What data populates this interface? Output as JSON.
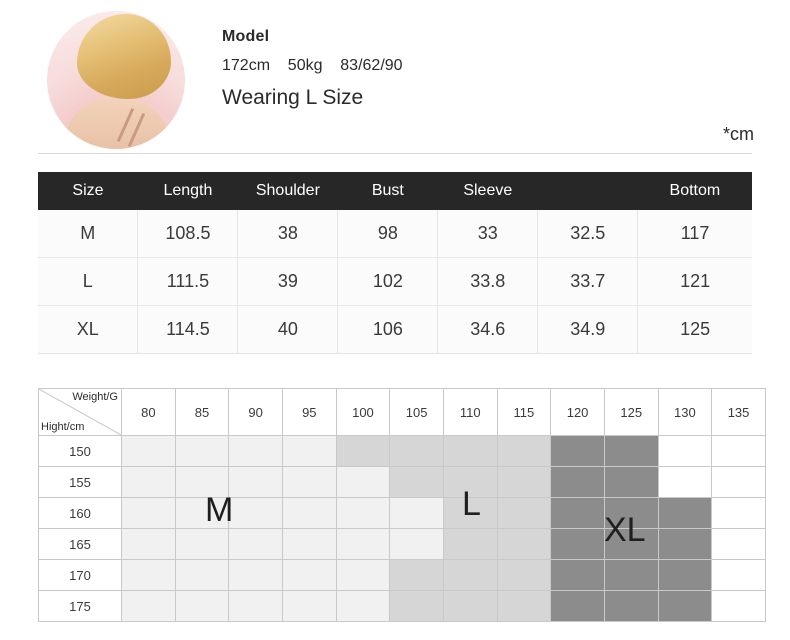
{
  "model": {
    "title": "Model",
    "specs": "172cm    50kg    83/62/90",
    "wearing": "Wearing L Size",
    "photo_alt": "model-portrait"
  },
  "unit_note": "*cm",
  "size_table": {
    "headers": [
      "Size",
      "Length",
      "Shoulder",
      "Bust",
      "Sleeve",
      "",
      "Bottom"
    ],
    "rows": [
      {
        "size": "M",
        "values": [
          "108.5",
          "38",
          "98",
          "33",
          "32.5",
          "117"
        ]
      },
      {
        "size": "L",
        "values": [
          "111.5",
          "39",
          "102",
          "33.8",
          "33.7",
          "121"
        ]
      },
      {
        "size": "XL",
        "values": [
          "114.5",
          "40",
          "106",
          "34.6",
          "34.9",
          "125"
        ]
      }
    ]
  },
  "fit_grid": {
    "corner_weight_label": "Weight/G",
    "corner_height_label": "Hight/cm",
    "weights": [
      "80",
      "85",
      "90",
      "95",
      "100",
      "105",
      "110",
      "115",
      "120",
      "125",
      "130",
      "135"
    ],
    "heights": [
      "150",
      "155",
      "160",
      "165",
      "170",
      "175"
    ],
    "shade_colors": {
      "none": "#ffffff",
      "light": "#f1f1f1",
      "medium": "#d6d6d6",
      "dark": "#8c8c8c"
    },
    "shading": [
      [
        1,
        1,
        1,
        1,
        2,
        2,
        2,
        2,
        3,
        3,
        0,
        0
      ],
      [
        1,
        1,
        1,
        1,
        1,
        2,
        2,
        2,
        3,
        3,
        0,
        0
      ],
      [
        1,
        1,
        1,
        1,
        1,
        1,
        2,
        2,
        3,
        3,
        3,
        0
      ],
      [
        1,
        1,
        1,
        1,
        1,
        1,
        2,
        2,
        3,
        3,
        3,
        0
      ],
      [
        1,
        1,
        1,
        1,
        1,
        2,
        2,
        2,
        3,
        3,
        3,
        0
      ],
      [
        1,
        1,
        1,
        1,
        1,
        2,
        2,
        2,
        3,
        3,
        3,
        0
      ]
    ],
    "zone_labels": [
      {
        "text": "M",
        "id": "zone-m"
      },
      {
        "text": "L",
        "id": "zone-l"
      },
      {
        "text": "XL",
        "id": "zone-xl"
      }
    ]
  },
  "chart_data": {
    "type": "heatmap",
    "title": "Size recommendation by height and weight",
    "xlabel": "Weight/G",
    "ylabel": "Hight/cm",
    "x": [
      "80",
      "85",
      "90",
      "95",
      "100",
      "105",
      "110",
      "115",
      "120",
      "125",
      "130",
      "135"
    ],
    "y": [
      "150",
      "155",
      "160",
      "165",
      "170",
      "175"
    ],
    "values": [
      [
        1,
        1,
        1,
        1,
        2,
        2,
        2,
        2,
        3,
        3,
        0,
        0
      ],
      [
        1,
        1,
        1,
        1,
        1,
        2,
        2,
        2,
        3,
        3,
        0,
        0
      ],
      [
        1,
        1,
        1,
        1,
        1,
        1,
        2,
        2,
        3,
        3,
        3,
        0
      ],
      [
        1,
        1,
        1,
        1,
        1,
        1,
        2,
        2,
        3,
        3,
        3,
        0
      ],
      [
        1,
        1,
        1,
        1,
        1,
        2,
        2,
        2,
        3,
        3,
        3,
        0
      ],
      [
        1,
        1,
        1,
        1,
        1,
        2,
        2,
        2,
        3,
        3,
        3,
        0
      ]
    ],
    "legend": [
      {
        "level": 1,
        "label": "M",
        "color": "#f1f1f1"
      },
      {
        "level": 2,
        "label": "L",
        "color": "#d6d6d6"
      },
      {
        "level": 3,
        "label": "XL",
        "color": "#8c8c8c"
      }
    ],
    "grid": true
  }
}
